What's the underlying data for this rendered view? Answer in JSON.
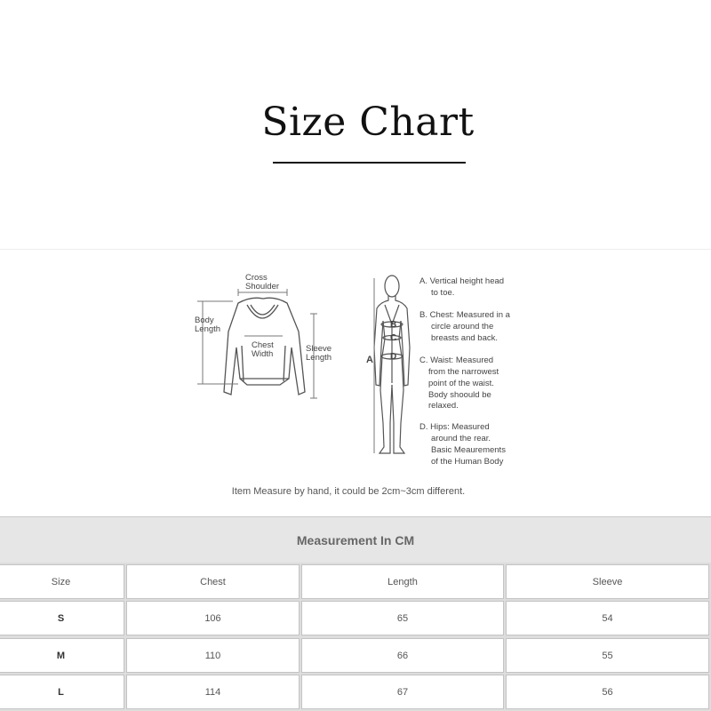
{
  "title": "Size Chart",
  "garment_labels": {
    "cross_shoulder": [
      "Cross",
      "Shoulder"
    ],
    "body_length": [
      "Body",
      "Length"
    ],
    "chest_width": [
      "Chest",
      "Width"
    ],
    "sleeve_length": [
      "Sleeve",
      "Length"
    ]
  },
  "body_markers": {
    "a": "A",
    "b": "B",
    "c": "C",
    "d": "D"
  },
  "body_notes": [
    [
      "A. Vertical height head",
      "to toe."
    ],
    [
      "B. Chest: Measured in a",
      "circle around the",
      "breasts and back."
    ],
    [
      "C. Waist: Measured",
      "from the narrowest",
      "point of the waist.",
      "Body shoould be",
      "relaxed."
    ],
    [
      "D. Hips: Measured",
      "around the rear.",
      "Basic Meaurements",
      "of the Human Body"
    ]
  ],
  "note": "Item Measure by hand, it could be 2cm~3cm different.",
  "table": {
    "heading": "Measurement In CM",
    "columns": [
      "Size",
      "Chest",
      "Length",
      "Sleeve"
    ],
    "rows": [
      [
        "S",
        "106",
        "65",
        "54"
      ],
      [
        "M",
        "110",
        "66",
        "55"
      ],
      [
        "L",
        "114",
        "67",
        "56"
      ]
    ]
  }
}
